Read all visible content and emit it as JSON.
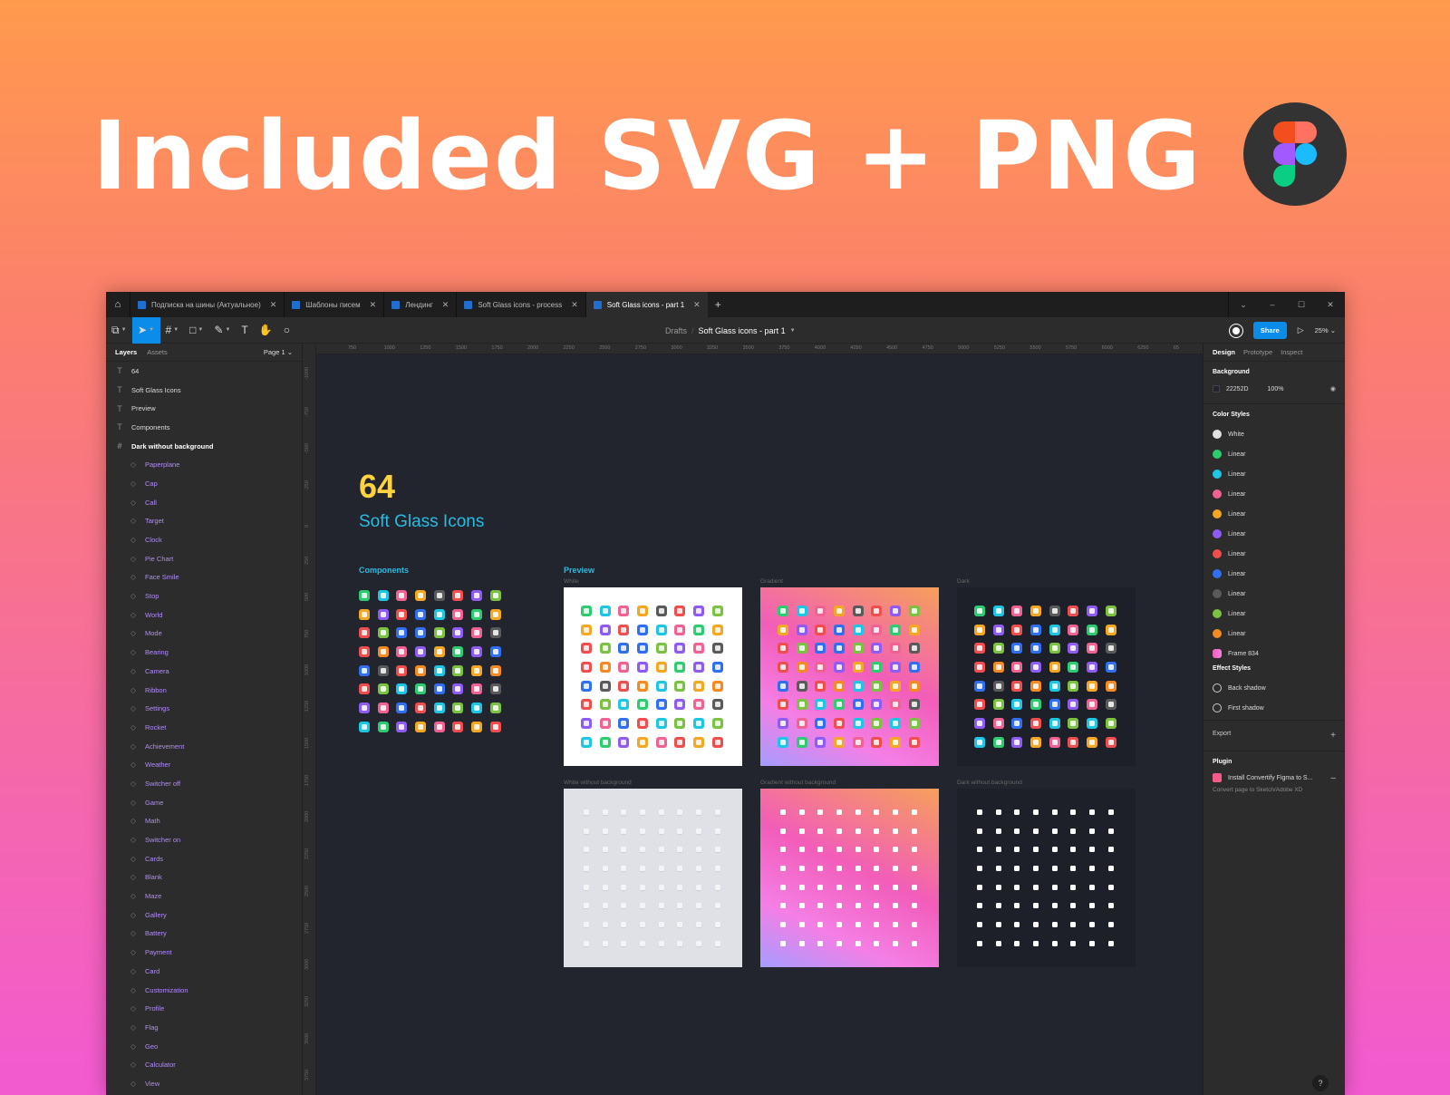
{
  "hero": {
    "headline": "Included SVG + PNG",
    "badge_icon": "figma-logo-icon"
  },
  "app": {
    "tabs": [
      {
        "label": "Подписка на шины (Актуальное)",
        "active": false
      },
      {
        "label": "Шаблоны писем",
        "active": false
      },
      {
        "label": "Лендинг",
        "active": false
      },
      {
        "label": "Soft Glass icons - process",
        "active": false
      },
      {
        "label": "Soft Glass icons - part 1",
        "active": true
      }
    ],
    "new_tab": "+",
    "window_controls": [
      "⌄",
      "–",
      "☐",
      "✕"
    ],
    "toolbar": {
      "tools": [
        "main-menu",
        "move",
        "frame",
        "shape",
        "pen",
        "text",
        "hand",
        "comment"
      ],
      "breadcrumb_parent": "Drafts",
      "breadcrumb_sep": "/",
      "file_name": "Soft Glass icons - part 1",
      "share_label": "Share",
      "zoom": "25%"
    },
    "left_panel": {
      "tab_layers": "Layers",
      "tab_assets": "Assets",
      "page": "Page 1",
      "layers": [
        {
          "type": "text",
          "label": "64"
        },
        {
          "type": "text",
          "label": "Soft Glass Icons"
        },
        {
          "type": "text",
          "label": "Preview"
        },
        {
          "type": "text",
          "label": "Components"
        },
        {
          "type": "frame",
          "label": "Dark without background"
        },
        {
          "type": "component",
          "label": "Paperplane"
        },
        {
          "type": "component",
          "label": "Cap"
        },
        {
          "type": "component",
          "label": "Call"
        },
        {
          "type": "component",
          "label": "Target"
        },
        {
          "type": "component",
          "label": "Clock"
        },
        {
          "type": "component",
          "label": "Pie Chart"
        },
        {
          "type": "component",
          "label": "Face Smile"
        },
        {
          "type": "component",
          "label": "Stop"
        },
        {
          "type": "component",
          "label": "World"
        },
        {
          "type": "component",
          "label": "Mode"
        },
        {
          "type": "component",
          "label": "Bearing"
        },
        {
          "type": "component",
          "label": "Camera"
        },
        {
          "type": "component",
          "label": "Ribbon"
        },
        {
          "type": "component",
          "label": "Settings"
        },
        {
          "type": "component",
          "label": "Rocket"
        },
        {
          "type": "component",
          "label": "Achievement"
        },
        {
          "type": "component",
          "label": "Weather"
        },
        {
          "type": "component",
          "label": "Switcher off"
        },
        {
          "type": "component",
          "label": "Game"
        },
        {
          "type": "component",
          "label": "Math"
        },
        {
          "type": "component",
          "label": "Switcher on"
        },
        {
          "type": "component",
          "label": "Cards"
        },
        {
          "type": "component",
          "label": "Blank"
        },
        {
          "type": "component",
          "label": "Maze"
        },
        {
          "type": "component",
          "label": "Gallery"
        },
        {
          "type": "component",
          "label": "Battery"
        },
        {
          "type": "component",
          "label": "Payment"
        },
        {
          "type": "component",
          "label": "Card"
        },
        {
          "type": "component",
          "label": "Customization"
        },
        {
          "type": "component",
          "label": "Profile"
        },
        {
          "type": "component",
          "label": "Flag"
        },
        {
          "type": "component",
          "label": "Geo"
        },
        {
          "type": "component",
          "label": "Calculator"
        },
        {
          "type": "component",
          "label": "View"
        }
      ]
    },
    "rulers": {
      "horizontal": [
        "750",
        "1000",
        "1250",
        "1500",
        "1750",
        "2000",
        "2250",
        "2500",
        "2750",
        "3000",
        "3250",
        "3500",
        "3750",
        "4000",
        "4250",
        "4500",
        "4750",
        "5000",
        "5250",
        "5500",
        "5750",
        "6000",
        "6250",
        "65"
      ],
      "vertical": [
        "-1000",
        "-750",
        "-500",
        "-250",
        "0",
        "250",
        "500",
        "750",
        "1000",
        "1250",
        "1500",
        "1750",
        "2000",
        "2250",
        "2500",
        "2750",
        "3000",
        "3250",
        "3500",
        "3750"
      ]
    },
    "canvas": {
      "count": "64",
      "title": "Soft Glass Icons",
      "components_label": "Components",
      "preview_label": "Preview",
      "frames": [
        {
          "label": "White",
          "style": "white"
        },
        {
          "label": "Gradient",
          "style": "grad"
        },
        {
          "label": "Dark",
          "style": "dark"
        },
        {
          "label": "White without background",
          "style": "lgray"
        },
        {
          "label": "Gradient without background",
          "style": "grad"
        },
        {
          "label": "Dark without background",
          "style": "dark"
        }
      ],
      "icon_colors": [
        "#2ecc71",
        "#1ec6e6",
        "#f06292",
        "#f5a623",
        "#5a5a5a",
        "#f04e4e",
        "#8e5cf2",
        "#7cc242",
        "#f5a623",
        "#8e5cf2",
        "#f04e4e",
        "#2f6ff0",
        "#1ec6e6",
        "#f06292",
        "#2ecc71",
        "#f5a623",
        "#f04e4e",
        "#7cc242",
        "#2f6ff0",
        "#2f6ff0",
        "#7cc242",
        "#8e5cf2",
        "#f06292",
        "#5a5a5a",
        "#f04e4e",
        "#f58a23",
        "#f06292",
        "#8e5cf2",
        "#f5a623",
        "#2ecc71",
        "#8e5cf2",
        "#2f6ff0",
        "#2f6ff0",
        "#5a5a5a",
        "#f04e4e",
        "#f58a23",
        "#1ec6e6",
        "#7cc242",
        "#f5a623",
        "#f58a23",
        "#f04e4e",
        "#7cc242",
        "#1ec6e6",
        "#2ecc71",
        "#2f6ff0",
        "#8e5cf2",
        "#f06292",
        "#5a5a5a",
        "#8e5cf2",
        "#f06292",
        "#2f6ff0",
        "#f04e4e",
        "#1ec6e6",
        "#7cc242",
        "#1ec6e6",
        "#7cc242",
        "#1ec6e6",
        "#2ecc71",
        "#8e5cf2",
        "#f5a623",
        "#f06292",
        "#f04e4e",
        "#f5a623",
        "#f04e4e"
      ]
    },
    "right_panel": {
      "tabs": [
        "Design",
        "Prototype",
        "Inspect"
      ],
      "background_label": "Background",
      "background_hex": "22252D",
      "background_opacity": "100%",
      "color_styles_label": "Color Styles",
      "color_styles": [
        {
          "name": "White",
          "color": "#e0e0e0"
        },
        {
          "name": "Linear",
          "color": "#2ecc71"
        },
        {
          "name": "Linear",
          "color": "#1ec6e6"
        },
        {
          "name": "Linear",
          "color": "#f06292"
        },
        {
          "name": "Linear",
          "color": "#f5a623"
        },
        {
          "name": "Linear",
          "color": "#8e5cf2"
        },
        {
          "name": "Linear",
          "color": "#f04e4e"
        },
        {
          "name": "Linear",
          "color": "#2f6ff0"
        },
        {
          "name": "Linear",
          "color": "#5a5a5a"
        },
        {
          "name": "Linear",
          "color": "#7cc242"
        },
        {
          "name": "Linear",
          "color": "#f58a23"
        },
        {
          "name": "Frame 834",
          "color": "#f25db9"
        }
      ],
      "effect_styles_label": "Effect Styles",
      "effect_styles": [
        "Back shadow",
        "First shadow"
      ],
      "export_label": "Export",
      "plugin_label": "Plugin",
      "plugin_name": "Install Convertify Figma to S...",
      "plugin_desc": "Convert page to Sketch/Adobe XD"
    },
    "help": "?"
  }
}
